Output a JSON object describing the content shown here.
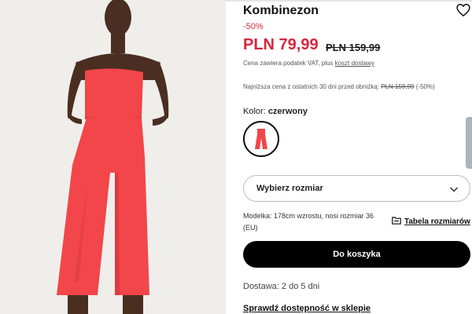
{
  "product": {
    "title": "Kombinezon",
    "discount": "-50%",
    "price": "PLN 79,99",
    "old_price": "PLN 159,99",
    "vat_text": "Cena zawiera podatek VAT, plus",
    "vat_link": "koszt dostawy",
    "lowest_prefix": "Najniższa cena z ostatnich 30 dni przed obniżką:",
    "lowest_price": "PLN 159,99",
    "lowest_discount": "(-50%)"
  },
  "color": {
    "label": "Kolor:",
    "value": "czerwony",
    "swatch_color": "#f2464a"
  },
  "size": {
    "placeholder": "Wybierz rozmiar",
    "model_note": "Modelka: 178cm wzrostu, nosi rozmiar 36 (EU)",
    "table_link": "Tabela rozmiarów"
  },
  "actions": {
    "cart_label": "Do koszyka",
    "delivery": "Dostawa: 2 do 5 dni",
    "store_link": "Sprawdź dostępność w sklepie"
  },
  "icons": {
    "wishlist": "heart-icon",
    "chevron": "chevron-down-icon",
    "size_table": "folder-icon"
  },
  "colors": {
    "sale_red": "#d7263d",
    "garment": "#f2464a",
    "button": "#000000"
  }
}
